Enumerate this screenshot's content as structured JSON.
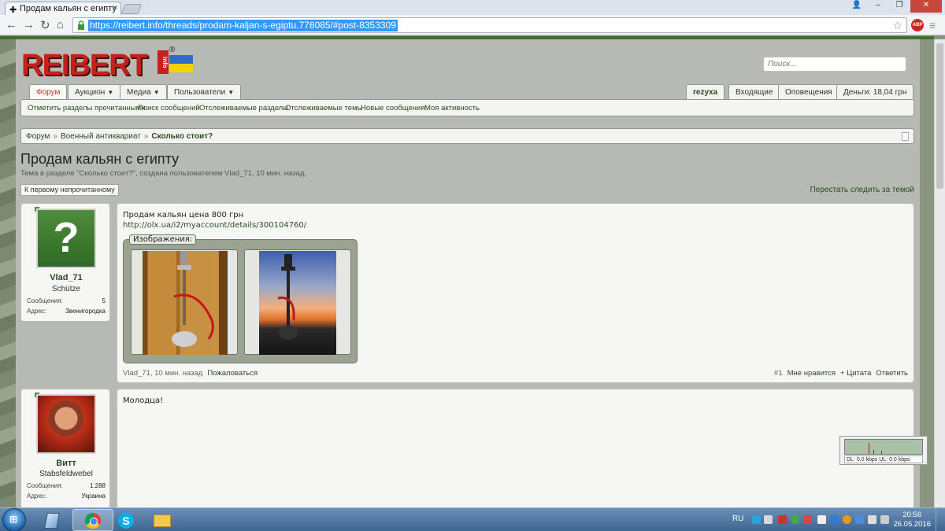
{
  "browser": {
    "tab_title": "Продам кальян с египту",
    "url": "https://reibert.info/threads/prodam-kaljan-s-egiptu.776085/#post-8353309",
    "abp_label": "ABP"
  },
  "site": {
    "logo_text": "REIBERT",
    "logo_info": "info",
    "logo_reg": "®",
    "search_placeholder": "Поиск..."
  },
  "nav": {
    "tabs": [
      "Форум",
      "Аукцион",
      "Медиа",
      "Пользователи"
    ],
    "user_buttons": [
      "rezyxa",
      "Входящие",
      "Оповещения",
      "Деньги: 18,04 грн"
    ],
    "sublinks": [
      "Отметить разделы прочитанными",
      "Поиск сообщений",
      "Отслеживаемые разделы",
      "Отслеживаемые темы",
      "Новые сообщения",
      "Моя активность"
    ]
  },
  "breadcrumb": {
    "items": [
      "Форум",
      "Военный антиквариат",
      "Сколько стоит?"
    ],
    "sep": "»"
  },
  "thread": {
    "title": "Продам кальян с египту",
    "description": "Тема в разделе \"Сколько стоит?\", создана пользователем Vlad_71, 10 мин. назад.",
    "first_unread_button": "К первому непрочитанному",
    "unwatch_link": "Перестать следить за темой"
  },
  "posts": [
    {
      "author": "Vlad_71",
      "user_title": "Schütze",
      "stats": [
        {
          "label": "Сообщения:",
          "value": "5"
        },
        {
          "label": "Адрес:",
          "value": "Звенигородка"
        }
      ],
      "text": "Продам кальян цена 800 грн",
      "link": "http://olx.ua/i2/myaccount/details/300104760/",
      "attachments_label": "Изображения:",
      "footer_author_time": "Vlad_71, 10 мин. назад",
      "footer_report": "Пожаловаться",
      "post_number": "#1",
      "actions": [
        "Мне нравится",
        "+ Цитата",
        "Ответить"
      ]
    },
    {
      "author": "Витт",
      "user_title": "Stabsfeldwebel",
      "stats": [
        {
          "label": "Сообщения:",
          "value": "1.288"
        },
        {
          "label": "Адрес:",
          "value": "Украина"
        }
      ],
      "text": "Молодца!"
    }
  ],
  "traffic_widget": {
    "text": "DL: 0.0 kbps  UL: 0.0 kbps"
  },
  "taskbar": {
    "lang": "RU",
    "time": "20:56",
    "date": "26.05.2016"
  },
  "colors": {
    "brand_red": "#c4201c",
    "link_green": "#2a4a1f",
    "accent_green": "#3f6e2e"
  }
}
